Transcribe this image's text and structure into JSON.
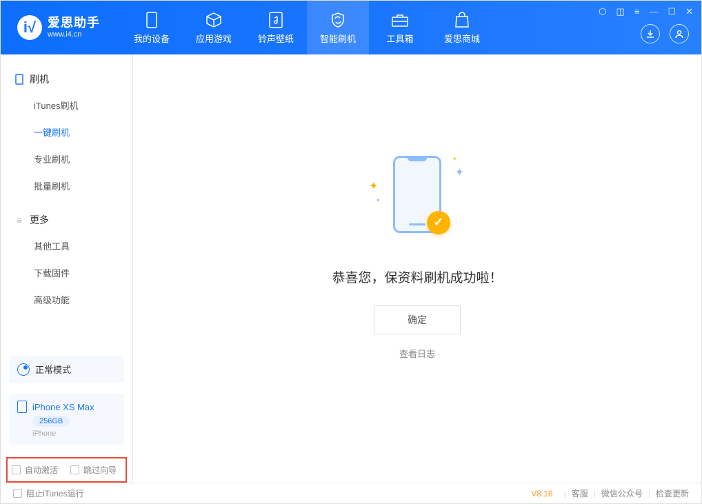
{
  "app": {
    "title": "爱思助手",
    "subtitle": "www.i4.cn"
  },
  "nav": {
    "tabs": [
      {
        "label": "我的设备"
      },
      {
        "label": "应用游戏"
      },
      {
        "label": "铃声壁纸"
      },
      {
        "label": "智能刷机"
      },
      {
        "label": "工具箱"
      },
      {
        "label": "爱思商城"
      }
    ]
  },
  "sidebar": {
    "group1": {
      "title": "刷机",
      "items": [
        "iTunes刷机",
        "一键刷机",
        "专业刷机",
        "批量刷机"
      ]
    },
    "group2": {
      "title": "更多",
      "items": [
        "其他工具",
        "下载固件",
        "高级功能"
      ]
    }
  },
  "mode": {
    "label": "正常模式"
  },
  "device": {
    "name": "iPhone XS Max",
    "storage": "256GB",
    "type": "iPhone"
  },
  "options": {
    "auto_activate": "自动激活",
    "skip_guide": "跳过向导"
  },
  "main": {
    "success_msg": "恭喜您，保资料刷机成功啦！",
    "confirm": "确定",
    "view_log": "查看日志"
  },
  "footer": {
    "block_itunes": "阻止iTunes运行",
    "version": "V8.16",
    "links": [
      "客服",
      "微信公众号",
      "检查更新"
    ]
  }
}
